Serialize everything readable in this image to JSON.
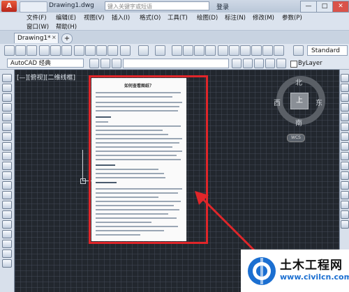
{
  "titlebar": {
    "app_icon": "A",
    "document": "Drawing1.dwg",
    "search_placeholder": "键入关键字或短语",
    "login": "登录",
    "buttons": [
      "—",
      "□",
      "✕"
    ]
  },
  "menu": {
    "row1": [
      "文件(F)",
      "编辑(E)",
      "视图(V)",
      "插入(I)",
      "格式(O)",
      "工具(T)",
      "绘图(D)",
      "标注(N)",
      "修改(M)",
      "参数(P)"
    ],
    "row2": [
      "窗口(W)",
      "帮助(H)"
    ]
  },
  "tabs": {
    "active": "Drawing1*",
    "close": "×",
    "add": "+"
  },
  "toolbar": {
    "text_style": "Standard",
    "workspace": "AutoCAD 经典",
    "bylayer": "ByLayer"
  },
  "canvas": {
    "view_label": "[—][俯视][二维线框]",
    "page_title": "如何查看图纸？"
  },
  "viewcube": {
    "north": "北",
    "south": "南",
    "east": "东",
    "west": "西",
    "top": "上",
    "wcs": "WCS"
  },
  "watermark": {
    "name": "土木工程网",
    "url": "www.civilcn.com"
  },
  "colors": {
    "highlight_box": "#e0262a",
    "canvas_bg": "#22272e",
    "watermark_blue": "#1b6fd1"
  }
}
